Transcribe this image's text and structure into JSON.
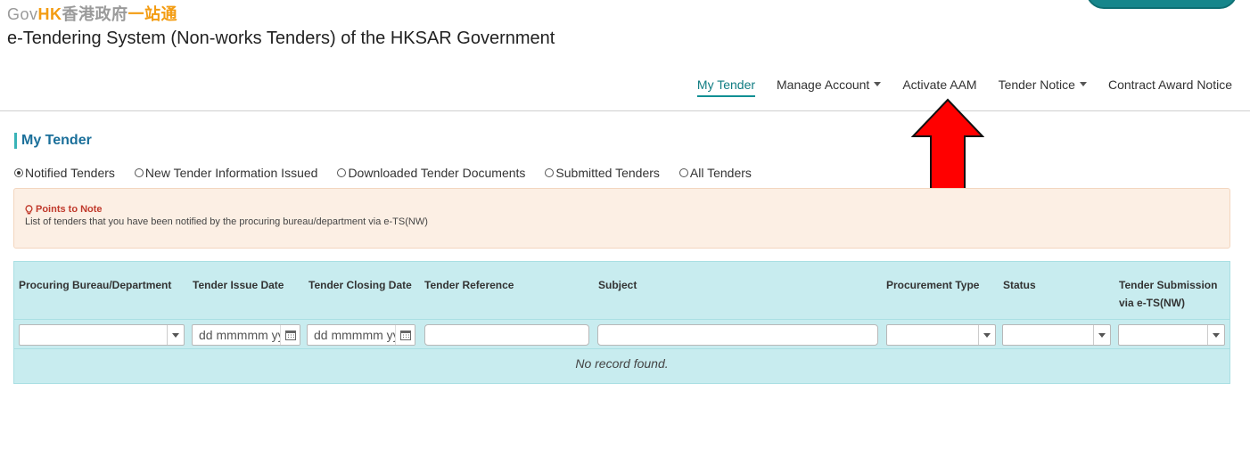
{
  "brand": {
    "logo_gov": "Gov",
    "logo_hk": "HK",
    "logo_zh": "香港政府",
    "logo_zh_highlight": "一站通",
    "system_title": "e-Tendering System (Non-works Tenders) of the HKSAR Government"
  },
  "nav": {
    "items": [
      {
        "label": "My Tender",
        "dropdown": false,
        "active": true
      },
      {
        "label": "Manage Account",
        "dropdown": true,
        "active": false
      },
      {
        "label": "Activate AAM",
        "dropdown": false,
        "active": false
      },
      {
        "label": "Tender Notice",
        "dropdown": true,
        "active": false
      },
      {
        "label": "Contract Award Notice",
        "dropdown": false,
        "active": false
      }
    ]
  },
  "page": {
    "title": "My Tender"
  },
  "filters": {
    "radios": [
      {
        "label": "Notified Tenders",
        "selected": true
      },
      {
        "label": "New Tender Information Issued",
        "selected": false
      },
      {
        "label": "Downloaded Tender Documents",
        "selected": false
      },
      {
        "label": "Submitted Tenders",
        "selected": false
      },
      {
        "label": "All Tenders",
        "selected": false
      }
    ]
  },
  "note": {
    "title": "Points to Note",
    "text": "List of tenders that you have been notified by the procuring bureau/department via e-TS(NW)"
  },
  "table": {
    "headers": [
      "Procuring Bureau/Department",
      "Tender Issue Date",
      "Tender Closing Date",
      "Tender Reference",
      "Subject",
      "Procurement Type",
      "Status",
      "Tender Submission via e-TS(NW)"
    ],
    "date_placeholder": "dd mmmmm yy",
    "empty_message": "No record found."
  },
  "colors": {
    "accent": "#0f8f94",
    "table_bg": "#c8ecef",
    "note_bg": "#fcefe4",
    "arrow": "#ff0000"
  }
}
